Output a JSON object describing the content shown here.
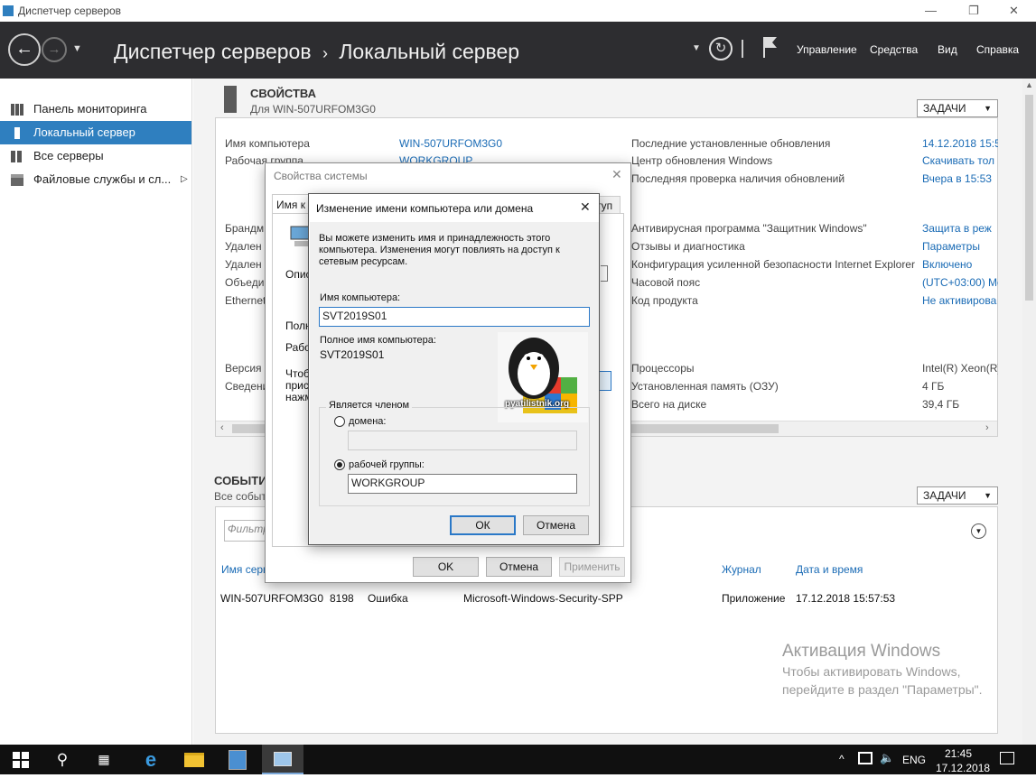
{
  "window": {
    "title": "Диспетчер серверов"
  },
  "header": {
    "breadcrumb_root": "Диспетчер серверов",
    "breadcrumb_sep": "›",
    "breadcrumb_page": "Локальный сервер",
    "menu": [
      "Управление",
      "Средства",
      "Вид",
      "Справка"
    ]
  },
  "sidebar": {
    "items": [
      {
        "label": "Панель мониторинга",
        "icon": "dashboard-icon"
      },
      {
        "label": "Локальный сервер",
        "icon": "server-icon",
        "active": true
      },
      {
        "label": "Все серверы",
        "icon": "servers-icon"
      },
      {
        "label": "Файловые службы и сл...",
        "icon": "file-services-icon",
        "chevron": "▷"
      }
    ]
  },
  "properties": {
    "title": "СВОЙСТВА",
    "subtitle": "Для WIN-507URFOM3G0",
    "tasks": "ЗАДАЧИ",
    "left_rows": [
      {
        "label": "Имя компьютера",
        "value": "WIN-507URFOM3G0"
      },
      {
        "label": "Рабочая группа",
        "value": "WORKGROUP"
      }
    ],
    "left_truncated": [
      "Брандм",
      "Удален",
      "Удален",
      "Объеди",
      "Ethernet"
    ],
    "left_truncated2": [
      "Версия",
      "Сведени"
    ],
    "right_rows_1": [
      {
        "label": "Последние установленные обновления",
        "value": "14.12.2018 15:5"
      },
      {
        "label": "Центр обновления Windows",
        "value": "Скачивать тол"
      },
      {
        "label": "Последняя проверка наличия обновлений",
        "value": "Вчера в 15:53"
      }
    ],
    "right_rows_2": [
      {
        "label": "Антивирусная программа \"Защитник Windows\"",
        "value": "Защита в реж"
      },
      {
        "label": "Отзывы и диагностика",
        "value": "Параметры"
      },
      {
        "label": "Конфигурация усиленной безопасности Internet Explorer",
        "value": "Включено"
      },
      {
        "label": "Часовой пояс",
        "value": "(UTC+03:00) Mo"
      },
      {
        "label": "Код продукта",
        "value": "Не активирова"
      }
    ],
    "right_rows_3": [
      {
        "label": "Процессоры",
        "value": "Intel(R) Xeon(R)"
      },
      {
        "label": "Установленная память (ОЗУ)",
        "value": "4 ГБ"
      },
      {
        "label": "Всего на диске",
        "value": "39,4 ГБ"
      }
    ]
  },
  "events": {
    "title": "СОБЫТИ",
    "subtitle": "Все событ",
    "tasks": "ЗАДАЧИ",
    "filter_placeholder": "Фильтр",
    "columns": [
      "Имя серв",
      "Журнал",
      "Дата и время"
    ],
    "row": {
      "server": "WIN-507URFOM3G0",
      "id": "8198",
      "level": "Ошибка",
      "source": "Microsoft-Windows-Security-SPP",
      "log": "Приложение",
      "datetime": "17.12.2018 15:57:53"
    }
  },
  "sysprops": {
    "title": "Свойства системы",
    "tab_visible": "Имя к",
    "tab_right": "туп",
    "frag_opis": "Описа",
    "frag_poln": "Полно",
    "frag_rabo": "Рабоч",
    "frag_chto": [
      "Чтобы",
      "присо",
      "нажм"
    ],
    "ok": "OK",
    "cancel": "Отмена",
    "apply": "Применить"
  },
  "rename": {
    "title": "Изменение имени компьютера или домена",
    "description": "Вы можете изменить имя и принадлежность этого компьютера. Изменения могут повлиять на доступ к сетевым ресурсам.",
    "computer_name_label": "Имя компьютера:",
    "computer_name_value": "SVT2019S01",
    "full_name_label": "Полное имя компьютера:",
    "full_name_value": "SVT2019S01",
    "member_of": "Является членом",
    "domain_label": "домена:",
    "domain_value": "",
    "workgroup_label": "рабочей группы:",
    "workgroup_value": "WORKGROUP",
    "ok": "ОК",
    "cancel": "Отмена",
    "logo_text": "pyatilistnik.org"
  },
  "watermark": {
    "line1": "Активация Windows",
    "line2": "Чтобы активировать Windows,",
    "line3": "перейдите в раздел \"Параметры\"."
  },
  "taskbar": {
    "lang": "ENG",
    "time": "21:45",
    "date": "17.12.2018"
  },
  "colors": {
    "accent": "#2f7fbf",
    "header_bg": "#2d2d30",
    "link": "#1a6bb5"
  }
}
